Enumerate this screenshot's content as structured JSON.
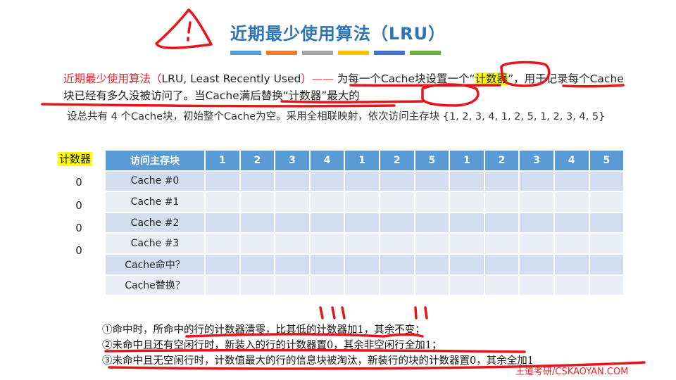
{
  "title": "近期最少使用算法（LRU）",
  "title_bar_colors": [
    "#5b9bd5",
    "#ed7d31",
    "#a5a5a5",
    "#ffc000",
    "#4472c4",
    "#70ad47"
  ],
  "intro": {
    "name_red": "近期最少使用算法（",
    "lru_term": "LRU, Least Recently Used",
    "close_red": "）——",
    "text_a": " 为每一个Cache块设置一个“",
    "counter_word": "计数器",
    "text_b": "”，用于记录每个Cache块已经有多久没被访问了。当Cache满后替换“计数器”最大的"
  },
  "setup": "设总共有 4 个Cache块，初始整个Cache为空。采用全相联映射，依次访问主存块 {1, 2, 3, 4, 1, 2, 5, 1, 2, 3, 4, 5}",
  "counter_label": "计数器",
  "counter_values": [
    "0",
    "0",
    "0",
    "0"
  ],
  "table": {
    "header_label": "访问主存块",
    "sequence": [
      "1",
      "2",
      "3",
      "4",
      "1",
      "2",
      "5",
      "1",
      "2",
      "3",
      "4",
      "5"
    ],
    "rows": [
      "Cache #0",
      "Cache #1",
      "Cache #2",
      "Cache #3",
      "Cache命中？",
      "Cache替换？"
    ]
  },
  "rules": [
    "①命中时，所命中的行的计数器清零，比其低的计数器加1，其余不变；",
    "②未命中且还有空闲行时，新装入的行的计数器置0，其余非空闲行全加1；",
    "③未命中且无空闲行时，计数值最大的行的信息块被淘汰，新装行的块的计数器置0，其余全加1"
  ],
  "brand": "王道考研/CSKAOYAN.COM",
  "ink_color": "#e8141c"
}
